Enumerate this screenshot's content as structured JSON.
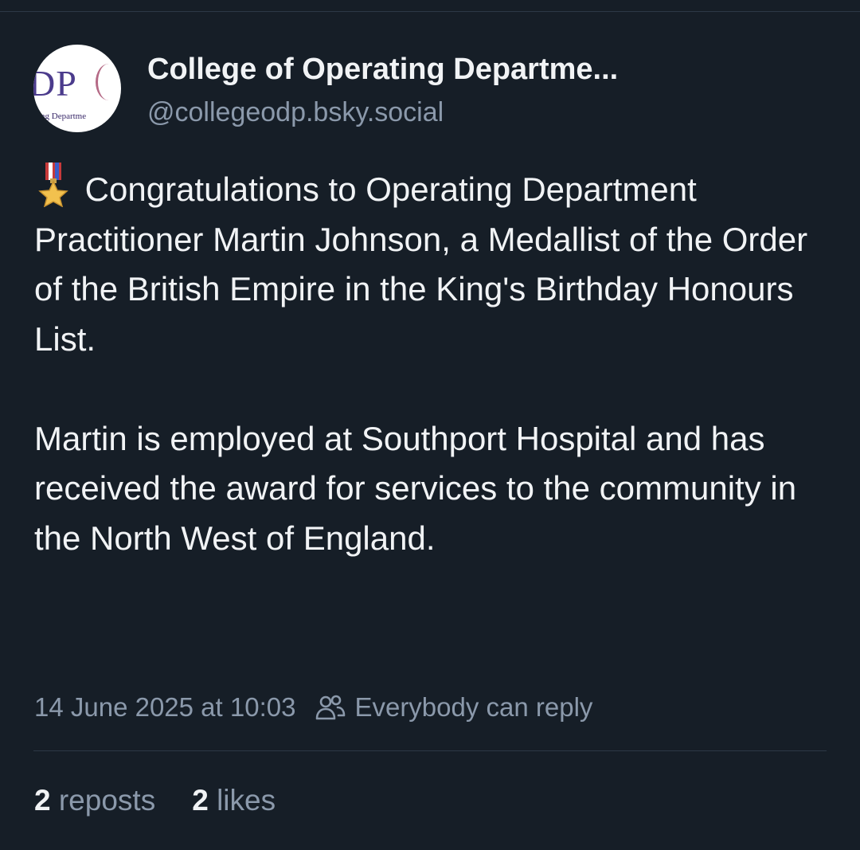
{
  "post": {
    "author": {
      "display_name": "College of Operating Departme...",
      "handle": "@collegeodp.bsky.social",
      "avatar_text": "DP",
      "avatar_subtext": "ating Departme"
    },
    "body": {
      "paragraph_1_emoji": "military-medal-emoji",
      "paragraph_1": "Congratulations to Operating Department Practitioner Martin Johnson, a Medallist of the Order of the British Empire in the King's Birthday Honours List.",
      "paragraph_2": "Martin is employed at Southport Hospital and has received the award for services to the community in the North West of England."
    },
    "timestamp": "14 June 2025 at 10:03",
    "reply_setting": {
      "icon": "people-icon",
      "label": "Everybody can reply"
    },
    "stats": {
      "reposts_count": "2",
      "reposts_label": "reposts",
      "likes_count": "2",
      "likes_label": "likes"
    }
  },
  "colors": {
    "background": "#161e27",
    "primary_text": "#f1f3f5",
    "secondary_text": "#8b99ab",
    "divider": "#2c3846"
  }
}
